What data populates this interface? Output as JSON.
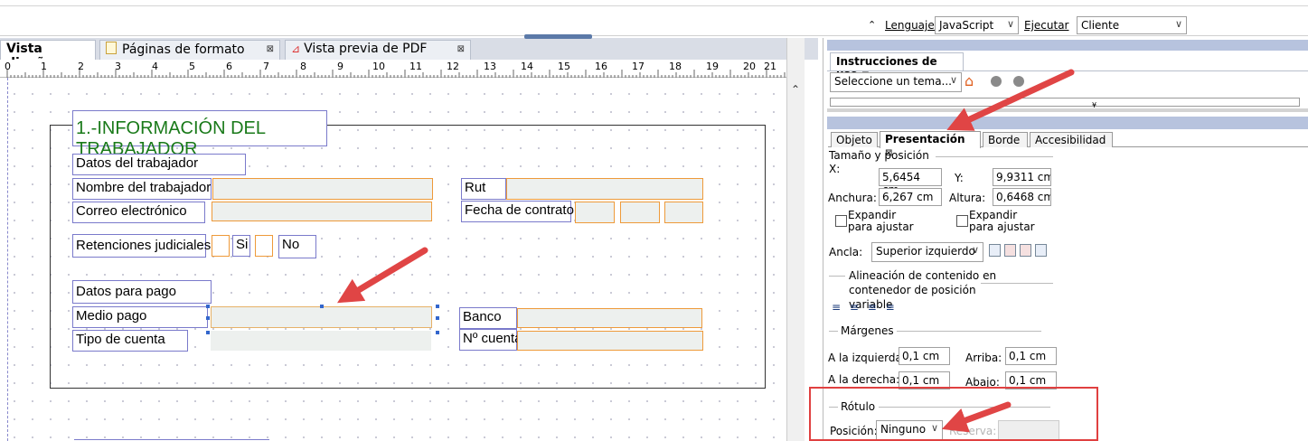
{
  "toolbar": {
    "language_label": "Lenguaje:",
    "language_value": "JavaScript",
    "execute_label": "Ejecutar",
    "execute_value": "Cliente"
  },
  "tabs": [
    {
      "label": "Vista diseño",
      "active": true
    },
    {
      "label": "Páginas de formato"
    },
    {
      "label": "Vista previa de PDF"
    }
  ],
  "ruler": [
    "0",
    "1",
    "2",
    "3",
    "4",
    "5",
    "6",
    "7",
    "8",
    "9",
    "10",
    "11",
    "12",
    "13",
    "14",
    "15",
    "16",
    "17",
    "18",
    "19",
    "20",
    "21"
  ],
  "form": {
    "section_title": "1.-INFORMACIÓN DEL TRABAJADOR",
    "worker_heading": "Datos del trabajador",
    "worker_name": "Nombre del trabajador",
    "email": "Correo electrónico",
    "rut": "Rut",
    "contract_date": "Fecha de contrato",
    "retentions": "Retenciones judiciales",
    "yes": "Si",
    "no": "No",
    "payment_heading": "Datos para pago",
    "payment_method": "Medio pago",
    "account_type": "Tipo de cuenta",
    "bank": "Banco",
    "account_number": "Nº cuenta"
  },
  "panel": {
    "help_title": "Instrucciones de uso",
    "help_select": "Seleccione un tema...",
    "tabs": [
      "Objeto",
      "Presentación",
      "Borde",
      "Accesibilidad"
    ],
    "size_pos": "Tamaño y posición",
    "x_label": "X:",
    "x_value": "5,6454 cm",
    "y_label": "Y:",
    "y_value": "9,9311 cm",
    "width_label": "Anchura:",
    "width_value": "6,267 cm",
    "height_label": "Altura:",
    "height_value": "0,6468 cm",
    "expand1": "Expandir para ajustar",
    "expand2": "Expandir para ajustar",
    "anchor_label": "Ancla:",
    "anchor_value": "Superior izquierdo",
    "align_title": "Alineación de contenido en contenedor de posición variable",
    "margins_title": "Márgenes",
    "left_label": "A la izquierda",
    "left_value": "0,1 cm",
    "top_label": "Arriba:",
    "top_value": "0,1 cm",
    "right_label": "A la derecha:",
    "right_value": "0,1 cm",
    "bottom_label": "Abajo:",
    "bottom_value": "0,1 cm",
    "caption_title": "Rótulo",
    "position_label": "Posición:",
    "position_value": "Ninguno",
    "reserve_label": "Reserva:"
  },
  "colors": {
    "accent_arrow": "#e04545",
    "title_green": "#1a7a1a",
    "field_border": "#ee9a3a"
  }
}
